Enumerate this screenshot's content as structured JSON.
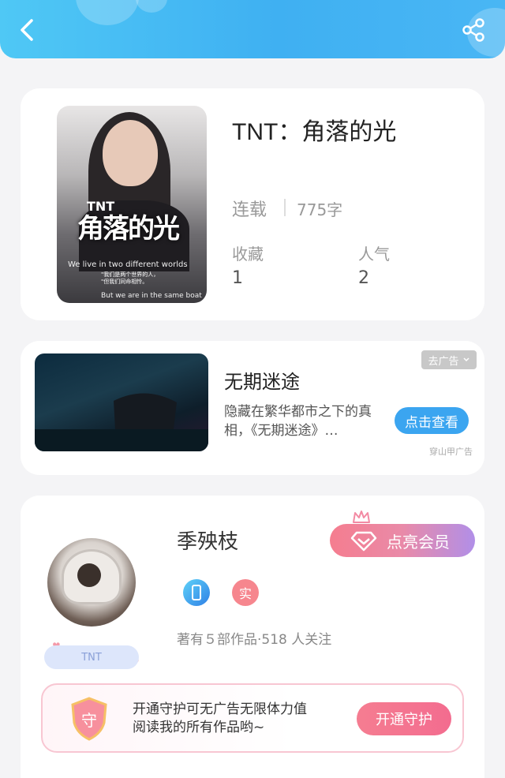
{
  "header": {
    "back_icon": "chevron-left-icon",
    "share_icon": "share-icon"
  },
  "book": {
    "title": "TNT：角落的光",
    "status": "连载",
    "word_count": "775字",
    "favorites_label": "收藏",
    "favorites_value": "1",
    "popularity_label": "人气",
    "popularity_value": "2",
    "cover": {
      "tag": "TNT",
      "title": "角落的光",
      "line1": "We live in two different worlds",
      "line2a": "\"我们是两个世界的人，",
      "line2b": "\"但我们同命相怜。",
      "line3": "But we are in the same boat"
    }
  },
  "ad": {
    "title": "无期迷途",
    "description": "隐藏在繁华都市之下的真相，《无期迷途》…",
    "remove_label": "去广告",
    "button_label": "点击查看",
    "source": "穿山甲广告"
  },
  "author": {
    "name": "季殃枝",
    "vip_button": "点亮会员",
    "badge_real": "实",
    "stats": "著有５部作品·518 人关注",
    "tag": "TNT",
    "guard": {
      "icon_text": "守",
      "line1": "开通守护可无广告无限体力值",
      "line2": "阅读我的所有作品哟~",
      "button": "开通守护"
    }
  },
  "colors": {
    "header_start": "#4fc8f5",
    "header_end": "#3fb0f2",
    "ad_button": "#3ba5f0",
    "vip_start": "#f57d8f",
    "vip_end": "#b18fe8",
    "guard_button": "#f36c8f"
  }
}
